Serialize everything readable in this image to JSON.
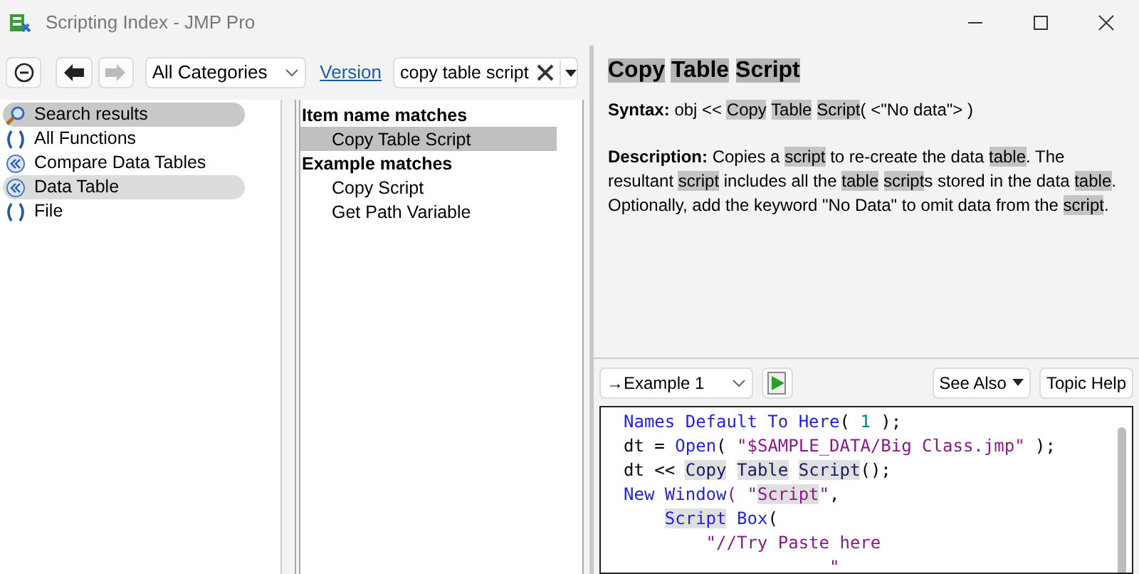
{
  "window": {
    "title": "Scripting Index - JMP Pro"
  },
  "toolbar": {
    "category": "All Categories",
    "version_link": "Version",
    "search_value": "copy table script"
  },
  "categories": [
    {
      "label": "Search results",
      "kind": "search",
      "selected": true
    },
    {
      "label": "All Functions",
      "kind": "function",
      "selected": false
    },
    {
      "label": "Compare Data Tables",
      "kind": "object",
      "selected": false
    },
    {
      "label": "Data Table",
      "kind": "object",
      "selected": true
    },
    {
      "label": "File",
      "kind": "function",
      "selected": false
    }
  ],
  "results": [
    {
      "heading": "Item name matches",
      "items": [
        {
          "label": "Copy Table Script",
          "selected": true
        }
      ]
    },
    {
      "heading": "Example matches",
      "items": [
        {
          "label": "Copy Script",
          "selected": false
        },
        {
          "label": "Get Path Variable",
          "selected": false
        }
      ]
    }
  ],
  "topic": {
    "title": [
      {
        "text": "Copy ",
        "highlighted": true
      },
      {
        "text": "Table ",
        "highlighted": true
      },
      {
        "text": "Script",
        "highlighted": true
      }
    ],
    "syntax_label": "Syntax:",
    "syntax": [
      {
        "text": "obj << ",
        "highlighted": false
      },
      {
        "text": "Copy ",
        "highlighted": true
      },
      {
        "text": "Table ",
        "highlighted": true
      },
      {
        "text": "Script",
        "highlighted": true
      },
      {
        "text": "( <\"No data\"> )",
        "highlighted": false
      }
    ],
    "description_label": "Description:",
    "description": [
      {
        "text": "Copies a ",
        "highlighted": false
      },
      {
        "text": "script",
        "highlighted": true
      },
      {
        "text": " to re-create the data  ",
        "highlighted": false
      },
      {
        "text": "table",
        "highlighted": true
      },
      {
        "text": ". The resultant ",
        "highlighted": false
      },
      {
        "text": "script",
        "highlighted": true
      },
      {
        "text": " includes all the ",
        "highlighted": false
      },
      {
        "text": "table ",
        "highlighted": true
      },
      {
        "text": "script",
        "highlighted": true
      },
      {
        "text": "s stored in the data ",
        "highlighted": false
      },
      {
        "text": "table",
        "highlighted": true
      },
      {
        "text": ". Optionally, add the keyword \"No Data\" to omit data from the  ",
        "highlighted": false
      },
      {
        "text": "script",
        "highlighted": true
      },
      {
        "text": ".",
        "highlighted": false
      }
    ]
  },
  "example_bar": {
    "example": "→Example 1",
    "see_also": "See Also",
    "topic_help": "Topic Help"
  },
  "code_lines": [
    [
      {
        "text": "Names Default To Here",
        "kind": "function",
        "highlighted": false
      },
      {
        "text": "( ",
        "kind": "plain",
        "highlighted": false
      },
      {
        "text": "1",
        "kind": "number",
        "highlighted": false
      },
      {
        "text": " );",
        "kind": "plain",
        "highlighted": false
      }
    ],
    [
      {
        "text": "dt = ",
        "kind": "plain",
        "highlighted": false
      },
      {
        "text": "Open",
        "kind": "function",
        "highlighted": false
      },
      {
        "text": "( ",
        "kind": "plain",
        "highlighted": false
      },
      {
        "text": "\"$SAMPLE_DATA/Big Class.jmp\"",
        "kind": "string",
        "highlighted": false
      },
      {
        "text": " );",
        "kind": "plain",
        "highlighted": false
      }
    ],
    [
      {
        "text": "dt << ",
        "kind": "plain",
        "highlighted": false
      },
      {
        "text": "Copy ",
        "kind": "message",
        "highlighted": true
      },
      {
        "text": "Table ",
        "kind": "message",
        "highlighted": true
      },
      {
        "text": "Script",
        "kind": "message",
        "highlighted": true
      },
      {
        "text": "();",
        "kind": "plain",
        "highlighted": false
      }
    ],
    [
      {
        "text": "New Window",
        "kind": "function",
        "highlighted": false
      },
      {
        "text": "( \"",
        "kind": "string",
        "highlighted": false
      },
      {
        "text": "Script",
        "kind": "string",
        "highlighted": true
      },
      {
        "text": "\"",
        "kind": "string",
        "highlighted": false
      },
      {
        "text": ",",
        "kind": "plain",
        "highlighted": false
      }
    ],
    [
      {
        "text": "    Script",
        "kind": "function",
        "highlighted": true
      },
      {
        "text": " Box",
        "kind": "function",
        "highlighted": false
      },
      {
        "text": "(",
        "kind": "plain",
        "highlighted": false
      }
    ],
    [
      {
        "text": "        \"//Try Paste here",
        "kind": "string",
        "highlighted": false
      }
    ],
    [
      {
        "text": "                    \"",
        "kind": "string",
        "highlighted": false
      }
    ]
  ]
}
